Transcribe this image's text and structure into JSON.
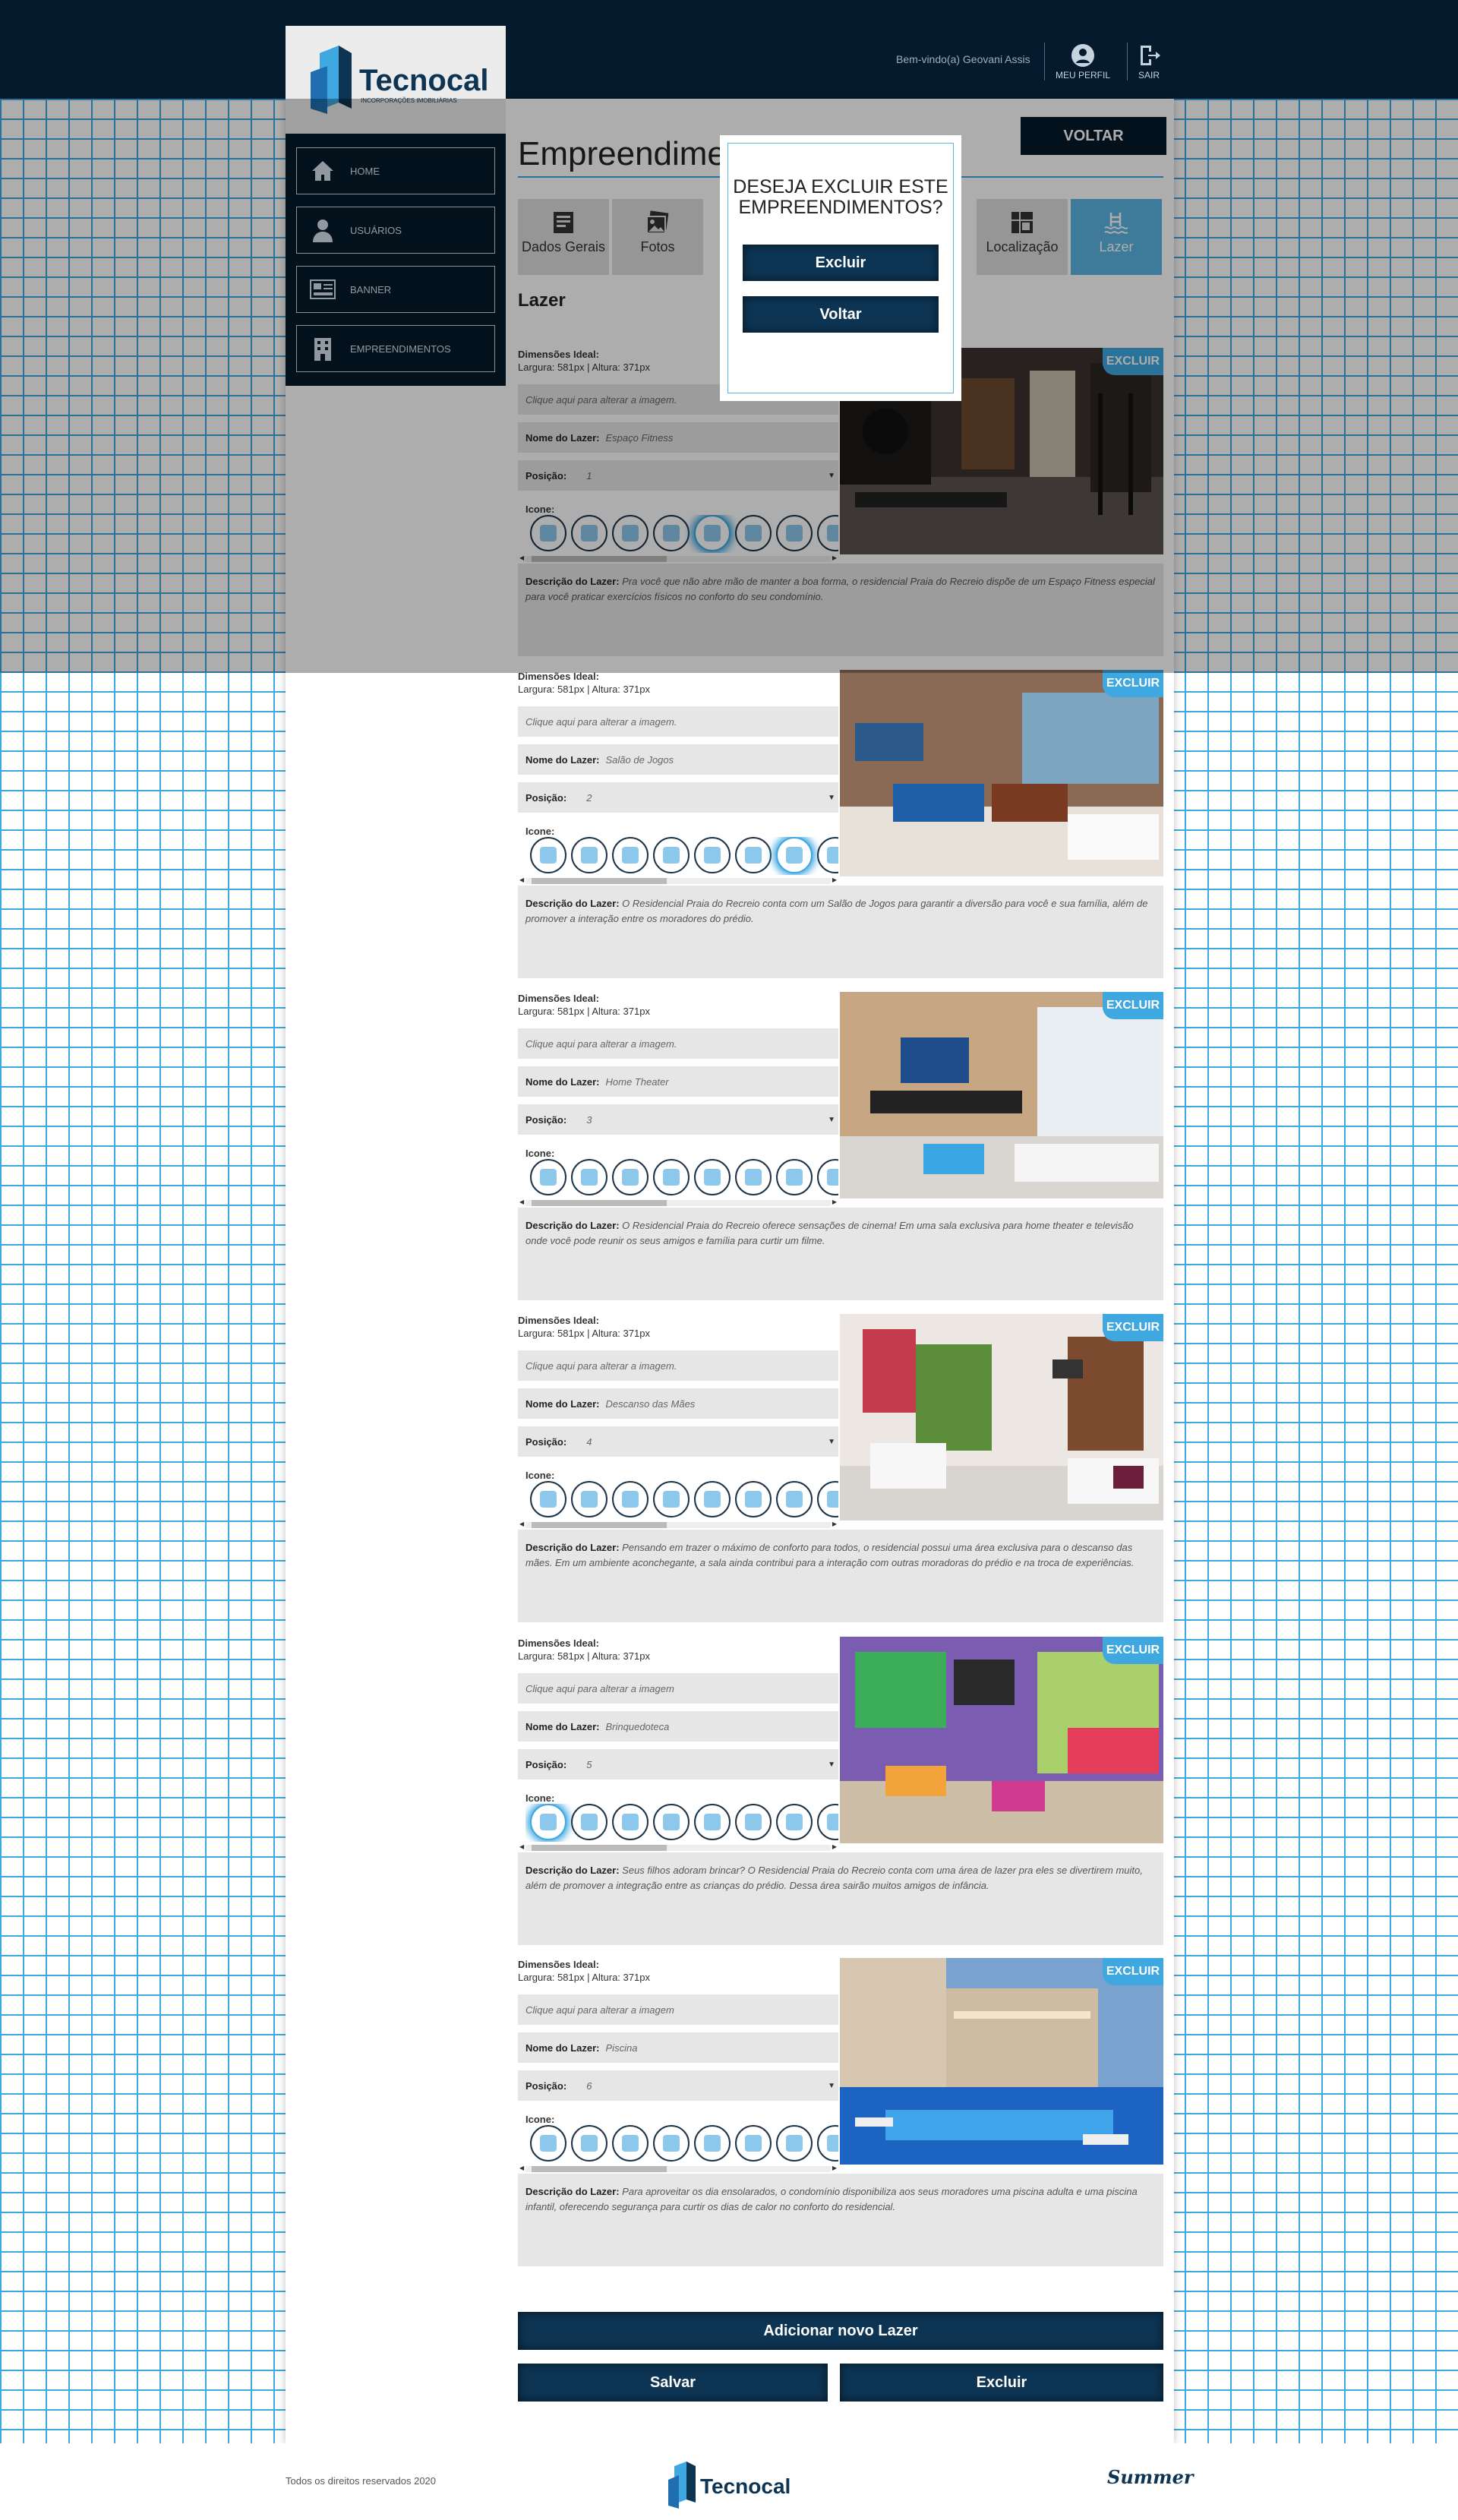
{
  "header": {
    "welcome": "Bem-vindo(a) Geovani Assis",
    "profile": "MEU PERFIL",
    "logout": "SAIR"
  },
  "brand": {
    "name": "Tecnocal",
    "tagline": "INCORPORAÇÕES IMOBILIÁRIAS"
  },
  "sidebar": {
    "items": [
      {
        "label": "HOME",
        "icon": "home-icon"
      },
      {
        "label": "USUÁRIOS",
        "icon": "user-icon"
      },
      {
        "label": "BANNER",
        "icon": "banner-icon"
      },
      {
        "label": "EMPREENDIMENTOS",
        "icon": "building-icon"
      }
    ]
  },
  "page": {
    "title": "Empreendimentos",
    "back": "VOLTAR",
    "section": "Lazer"
  },
  "tabs": [
    {
      "label": "Dados Gerais"
    },
    {
      "label": "Fotos"
    },
    {
      "label": "Localização"
    },
    {
      "label": "Lazer"
    }
  ],
  "modal": {
    "question": "DESEJA EXCLUIR ESTE EMPREENDIMENTOS?",
    "confirm": "Excluir",
    "cancel": "Voltar"
  },
  "labels": {
    "dim_title": "Dimensões Ideal:",
    "dim_value": "Largura: 581px | Altura: 371px",
    "image_hint": "Clique aqui para alterar a imagem.",
    "name": "Nome do Lazer:",
    "position": "Posição:",
    "icon": "Icone:",
    "desc": "Descrição do Lazer:",
    "delete": "EXCLUIR"
  },
  "items": [
    {
      "name": "Espaço Fitness",
      "position": "1",
      "image_hint": "Clique aqui para alterar a imagem.",
      "selected_icon": 4,
      "description": "Pra você que não abre mão de manter a boa forma, o residencial Praia do Recreio dispõe de um Espaço Fitness especial para você praticar exercícios físicos no conforto do seu condomínio."
    },
    {
      "name": "Salão de Jogos",
      "position": "2",
      "image_hint": "Clique aqui para alterar a imagem.",
      "selected_icon": 6,
      "description": "O Residencial Praia do Recreio conta com um Salão de Jogos para garantir a diversão para você e sua família, além de promover a interação entre os moradores do prédio."
    },
    {
      "name": "Home Theater",
      "position": "3",
      "image_hint": "Clique aqui para alterar a imagem.",
      "selected_icon": -1,
      "description": "O Residencial Praia do Recreio oferece sensações de cinema! Em uma sala exclusiva para home theater e televisão onde você pode reunir os seus amigos e família para curtir um filme."
    },
    {
      "name": "Descanso das Mães",
      "position": "4",
      "image_hint": "Clique aqui para alterar a imagem.",
      "selected_icon": -1,
      "description": "Pensando em trazer o máximo de conforto para todos, o residencial possui uma área exclusiva para o descanso das mães. Em um ambiente aconchegante, a sala ainda contribui para a interação com outras moradoras do prédio e na troca de experiências."
    },
    {
      "name": "Brinquedoteca",
      "position": "5",
      "image_hint": "Clique aqui para alterar a imagem",
      "selected_icon": 0,
      "description": "Seus filhos adoram brincar? O Residencial Praia do Recreio conta com uma área de lazer pra eles se divertirem muito, além de promover a integração entre as crianças do prédio. Dessa área sairão muitos amigos de infância."
    },
    {
      "name": "Piscina",
      "position": "6",
      "image_hint": "Clique aqui para alterar a imagem",
      "selected_icon": -1,
      "description": "Para aproveitar os dia ensolarados, o condomínio disponibiliza aos seus moradores uma piscina adulta e uma piscina infantil, oferecendo segurança para curtir os dias de calor no conforto do residencial."
    }
  ],
  "actions": {
    "add": "Adicionar novo Lazer",
    "save": "Salvar",
    "delete": "Excluir"
  },
  "footer": {
    "copyright": "Todos os direitos reservados 2020",
    "partner": "Summer"
  },
  "colors": {
    "navy": "#051a2c",
    "accent": "#40a8e0",
    "button": "#0d3453"
  }
}
